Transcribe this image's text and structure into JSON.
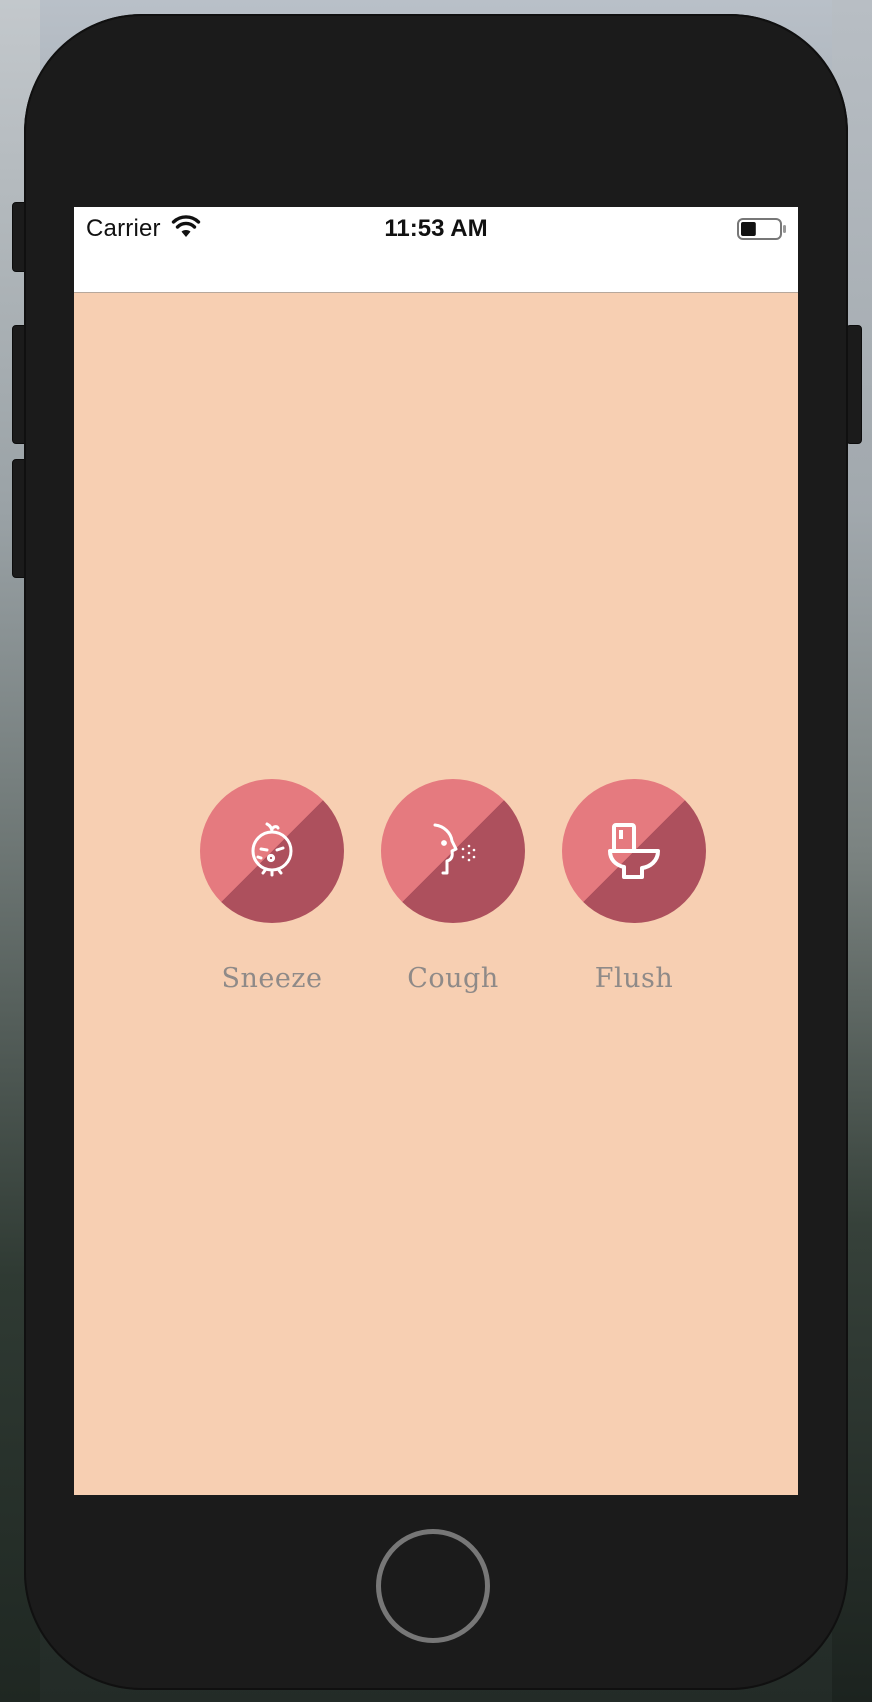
{
  "status_bar": {
    "carrier": "Carrier",
    "time": "11:53 AM",
    "wifi_icon": "wifi-icon",
    "battery_icon": "battery-icon",
    "battery_level": 0.4
  },
  "actions": [
    {
      "label": "Sneeze",
      "icon": "sneeze-face-icon"
    },
    {
      "label": "Cough",
      "icon": "cough-profile-icon"
    },
    {
      "label": "Flush",
      "icon": "toilet-icon"
    }
  ],
  "colors": {
    "screen_background": "#f7cfb2",
    "circle_light": "#e57a7f",
    "circle_dark": "#ad505d",
    "label_text": "#8f8a88",
    "phone_body": "#1b1b1b"
  }
}
